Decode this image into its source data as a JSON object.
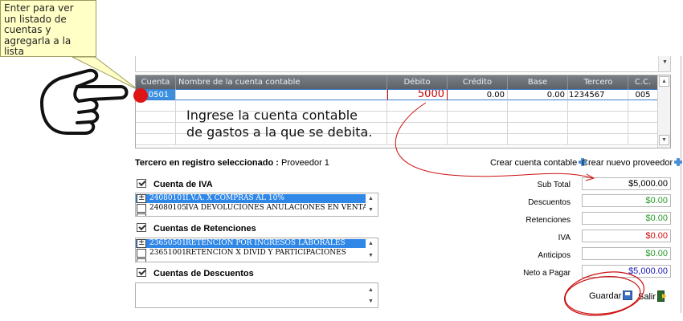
{
  "tooltip": {
    "lines": [
      "Enter para ver",
      "un listado de",
      "cuentas y",
      "agregarla a la lista"
    ]
  },
  "grid": {
    "columns": [
      "Cuenta",
      "Nombre de la cuenta contable",
      "Débito",
      "Crédito",
      "Base",
      "Tercero",
      "C.C."
    ],
    "row": {
      "cuenta": "050501",
      "nombre": "",
      "debito": "5000",
      "credito": "0.00",
      "base": "0.00",
      "tercero": "1234567",
      "cc": "005"
    }
  },
  "instruction": {
    "line1": "Ingrese la cuenta contable",
    "line2": "de gastos a la que se debita."
  },
  "tercero": {
    "label": "Tercero en registro seleccionado :",
    "value": "Proveedor 1"
  },
  "links": {
    "crear_cuenta": "Crear cuenta contable",
    "crear_proveedor": "Crear nuevo proveedor"
  },
  "iva": {
    "title": "Cuenta de IVA",
    "items": [
      {
        "code": "24080101",
        "desc": "I.V.A. X COMPRAS AL 10%",
        "selected": true
      },
      {
        "code": "24080105",
        "desc": "IVA  DEVOLUCIONES ANULACIONES EN VENTA",
        "selected": false
      }
    ]
  },
  "retenciones": {
    "title": "Cuentas de Retenciones",
    "items": [
      {
        "code": "23650501",
        "desc": "RETENCION POR INGRESOS LABORALES",
        "selected": true
      },
      {
        "code": "23651001",
        "desc": "RETENCION X DIVID Y PARTICIPACIONES",
        "selected": false
      }
    ]
  },
  "descuentos": {
    "title": "Cuentas de Descuentos"
  },
  "totals": {
    "subtotal_label": "Sub Total",
    "subtotal": "$5,000.00",
    "descuentos_label": "Descuentos",
    "descuentos": "$0.00",
    "retenciones_label": "Retenciones",
    "retenciones": "$0.00",
    "iva_label": "IVA",
    "iva": "$0.00",
    "anticipos_label": "Anticipos",
    "anticipos": "$0.00",
    "neto_label": "Neto a Pagar",
    "neto": "$5,000.00"
  },
  "actions": {
    "guardar": "Guardar",
    "salir": "Salir"
  },
  "colors": {
    "annotation_red": "#cc1111",
    "selection_blue": "#2f87e8",
    "header_gray": "#6a7076"
  },
  "icons": [
    "pointing-hand-icon",
    "plus-icon",
    "checkbox-icon",
    "floppy-disk-icon",
    "exit-door-icon"
  ]
}
